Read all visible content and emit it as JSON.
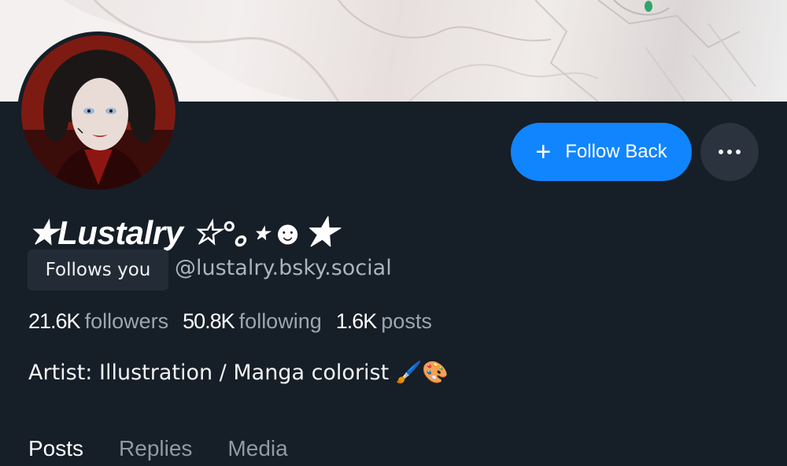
{
  "profile": {
    "display_name": "★Lustalry ☆°｡⋆☻★",
    "follows_badge": "Follows you",
    "handle": "@lustalry.bsky.social",
    "bio": "Artist: Illustration / Manga colorist 🖌️🎨"
  },
  "actions": {
    "follow_label": "Follow Back",
    "follow_icon": "+"
  },
  "stats": {
    "followers_count": "21.6K",
    "followers_label": "followers",
    "following_count": "50.8K",
    "following_label": "following",
    "posts_count": "1.6K",
    "posts_label": "posts"
  },
  "tabs": [
    {
      "label": "Posts"
    },
    {
      "label": "Replies"
    },
    {
      "label": "Media"
    }
  ],
  "colors": {
    "background": "#161e27",
    "accent": "#1185fe",
    "secondary_button": "#2a333e",
    "muted_text": "#9aa6b2"
  }
}
